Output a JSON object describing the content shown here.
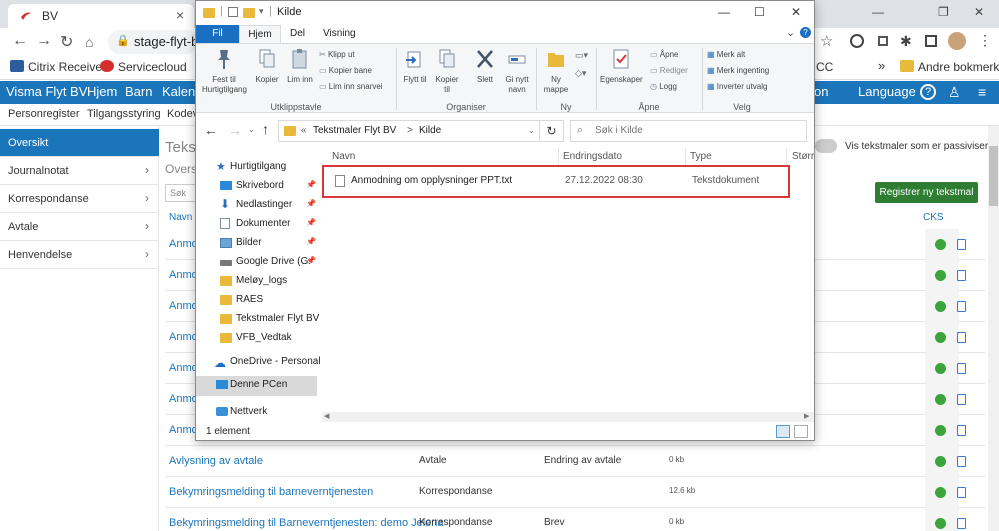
{
  "browser": {
    "tab_title": "BV",
    "close": "×",
    "address": "stage-flyt-ba",
    "bookmarks": [
      "Citrix Receiver",
      "Servicecloud"
    ],
    "bookmark_right": "Andre bokmerker",
    "bookmark_partial": "CC",
    "overflow": "»",
    "window_title": "Kilde",
    "window_buttons": {
      "min": "—",
      "max": "☐",
      "close": "✕"
    },
    "browser_window_buttons": {
      "min": "—",
      "restore": "❐",
      "close": "✕"
    }
  },
  "app": {
    "menu": [
      "Visma Flyt BV",
      "Hjem",
      "Barn",
      "Kalend"
    ],
    "menu_partial": "on",
    "language": "Language",
    "subnav": [
      "Personregister",
      "Tilgangsstyring",
      "Kodeve"
    ],
    "sidebar": [
      {
        "label": "Oversikt",
        "active": true
      },
      {
        "label": "Journalnotat",
        "active": false
      },
      {
        "label": "Korrespondanse",
        "active": false
      },
      {
        "label": "Avtale",
        "active": false
      },
      {
        "label": "Henvendelse",
        "active": false
      }
    ],
    "page_title": "Tekst",
    "page_sub": "Overs",
    "search_placeholder": "Søk",
    "col_name": "Navn",
    "col_cks": "CKS",
    "toggle_label": "Vis tekstmaler som er passivisert",
    "register_button": "Registrer ny tekstmal",
    "rows": [
      {
        "name": "Anmo",
        "c2": "",
        "c3": "",
        "c4": ""
      },
      {
        "name": "Anmo",
        "c2": "",
        "c3": "",
        "c4": ""
      },
      {
        "name": "Anmo",
        "c2": "",
        "c3": "",
        "c4": ""
      },
      {
        "name": "Anmo",
        "c2": "",
        "c3": "",
        "c4": ""
      },
      {
        "name": "Anmo",
        "c2": "",
        "c3": "",
        "c4": ""
      },
      {
        "name": "Anmo",
        "c2": "",
        "c3": "",
        "c4": ""
      },
      {
        "name": "Anmo",
        "c2": "",
        "c3": "",
        "c4": ""
      },
      {
        "name": "Avlysning av avtale",
        "c2": "Avtale",
        "c3": "Endring av avtale",
        "c4": "0 kb"
      },
      {
        "name": "Bekymringsmelding til barneverntjenesten",
        "c2": "Korrespondanse",
        "c3": "",
        "c4": "12.6 kb"
      },
      {
        "name": "Bekymringsmelding til Barneverntjenesten: demo Jelena",
        "c2": "Korrespondanse",
        "c3": "Brev",
        "c4": "0 kb"
      }
    ]
  },
  "explorer": {
    "title": "Kilde",
    "tabs": [
      "Fil",
      "Hjem",
      "Del",
      "Visning"
    ],
    "groups": {
      "clipboard": "Utklippstavle",
      "organize": "Organiser",
      "new": "Ny",
      "open": "Åpne",
      "select": "Velg"
    },
    "buttons": {
      "pin": "Fest til Hurtigtilgang",
      "copy": "Kopier",
      "paste": "Lim inn",
      "cut": "Klipp ut",
      "copy_path": "Kopier bane",
      "paste_shortcut": "Lim inn snarvei",
      "move": "Flytt til",
      "copy_to": "Kopier til",
      "delete": "Slett",
      "rename": "Gi nytt navn",
      "new_folder": "Ny mappe",
      "properties": "Egenskaper",
      "open": "Åpne",
      "edit": "Rediger",
      "history": "Logg",
      "select_all": "Merk alt",
      "select_none": "Merk ingenting",
      "invert": "Inverter utvalg"
    },
    "path": [
      "«",
      "Tekstmaler Flyt BV",
      ">",
      "Kilde"
    ],
    "search_placeholder": "Søk i Kilde",
    "nav": [
      {
        "label": "Hurtigtilgang",
        "icon": "star-icon",
        "pin": false
      },
      {
        "label": "Skrivebord",
        "icon": "desktop-icon",
        "pin": true
      },
      {
        "label": "Nedlastinger",
        "icon": "download-icon",
        "pin": true
      },
      {
        "label": "Dokumenter",
        "icon": "documents-icon",
        "pin": true
      },
      {
        "label": "Bilder",
        "icon": "pictures-icon",
        "pin": true
      },
      {
        "label": "Google Drive (G:",
        "icon": "drive-icon",
        "pin": true
      },
      {
        "label": "Meløy_logs",
        "icon": "folder-icon",
        "pin": false
      },
      {
        "label": "RAES",
        "icon": "folder-icon",
        "pin": false
      },
      {
        "label": "Tekstmaler Flyt BV",
        "icon": "folder-icon",
        "pin": false
      },
      {
        "label": "VFB_Vedtak",
        "icon": "folder-icon",
        "pin": false
      },
      {
        "label": "OneDrive - Personal",
        "icon": "cloud-icon",
        "pin": false
      },
      {
        "label": "Denne PCen",
        "icon": "pc-icon",
        "pin": false
      },
      {
        "label": "Nettverk",
        "icon": "network-icon",
        "pin": false
      }
    ],
    "columns": [
      "Navn",
      "Endringsdato",
      "Type",
      "Størr"
    ],
    "file": {
      "name": "Anmodning om opplysninger PPT.txt",
      "date": "27.12.2022 08:30",
      "type": "Tekstdokument"
    },
    "status": "1 element"
  },
  "colors": {
    "accent": "#1b75bb",
    "green": "#2e7d32",
    "highlight": "#d9383a"
  }
}
